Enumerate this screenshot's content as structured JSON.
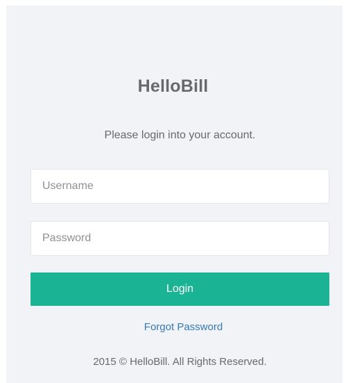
{
  "app": {
    "title": "HelloBill",
    "subtitle": "Please login into your account."
  },
  "form": {
    "username_placeholder": "Username",
    "username_value": "",
    "password_placeholder": "Password",
    "password_value": "",
    "login_label": "Login",
    "forgot_label": "Forgot Password"
  },
  "footer": {
    "copyright": "2015 © HelloBill. All Rights Reserved."
  },
  "colors": {
    "accent": "#1ab394",
    "link": "#337ab7",
    "panel_bg": "#f1f3f6",
    "text": "#676a6c"
  }
}
